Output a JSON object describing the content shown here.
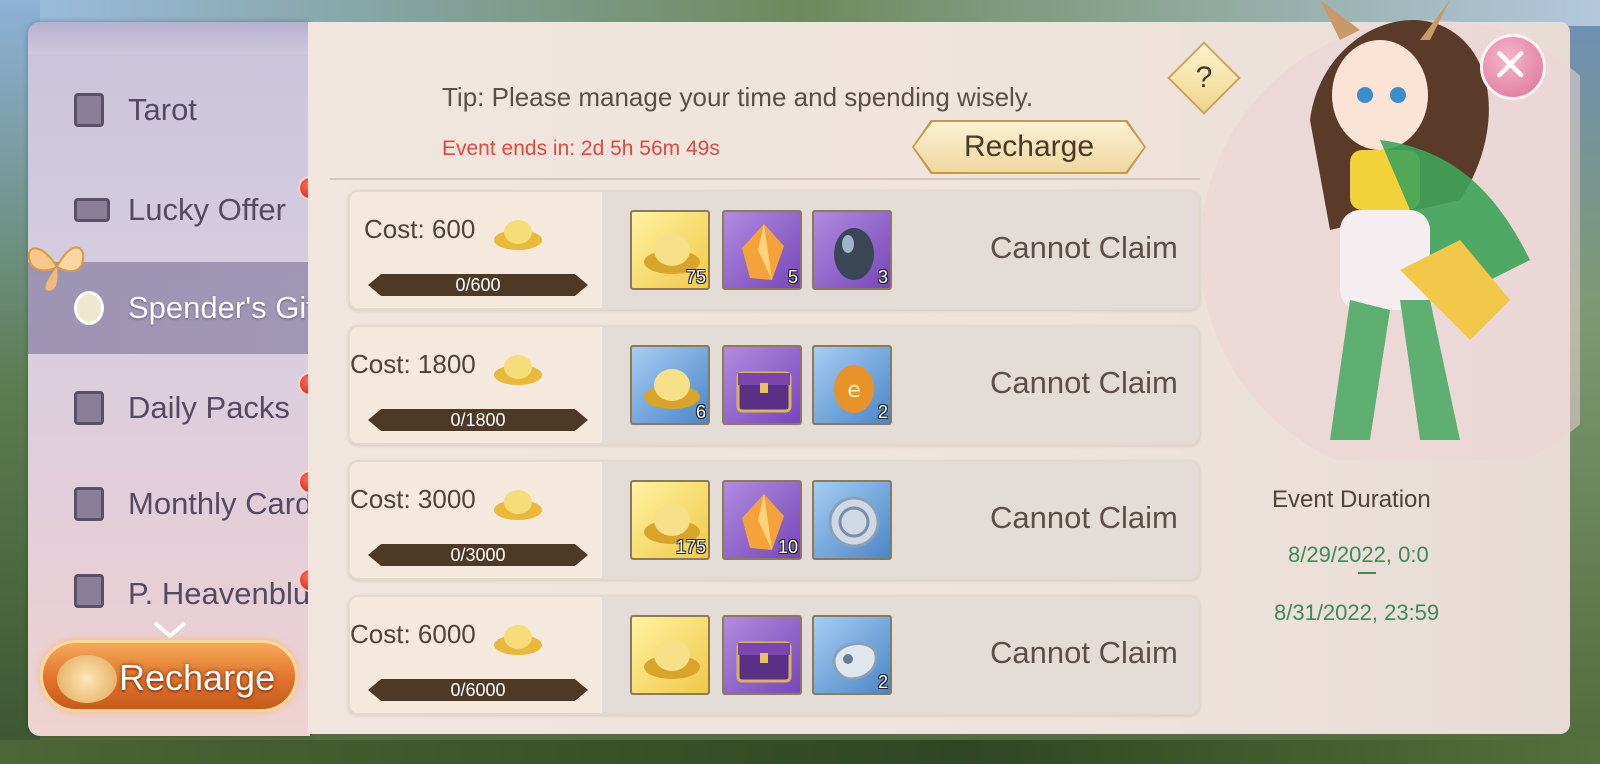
{
  "nav": {
    "items": [
      {
        "label": "Tarot",
        "icon": "tarot-card-icon",
        "badge": false,
        "active": false
      },
      {
        "label": "Lucky Offer",
        "icon": "ticket-icon",
        "badge": true,
        "active": false
      },
      {
        "label": "Spender's Gift",
        "icon": "ingot-icon",
        "badge": false,
        "active": true
      },
      {
        "label": "Daily Packs",
        "icon": "gift-box-icon",
        "badge": true,
        "active": false
      },
      {
        "label": "Monthly Card",
        "icon": "card-icon",
        "badge": true,
        "active": false
      },
      {
        "label": "P. Heavenblue",
        "icon": "shield-icon",
        "badge": true,
        "active": false
      }
    ],
    "recharge_label": "Recharge"
  },
  "header": {
    "tip": "Tip: Please manage your time and spending wisely.",
    "event_ends": "Event ends in: 2d 5h 56m 49s",
    "recharge_label": "Recharge",
    "help_label": "?"
  },
  "rewards": [
    {
      "cost": "Cost: 600",
      "progress": "0/600",
      "progress_fraction": 0,
      "status": "Cannot Claim",
      "items": [
        {
          "icon": "ingot-icon",
          "color": "gold",
          "count": "75"
        },
        {
          "icon": "crystal-icon",
          "color": "purple",
          "count": "5"
        },
        {
          "icon": "egg-icon",
          "color": "purple",
          "count": "3"
        }
      ]
    },
    {
      "cost": "Cost: 1800",
      "progress": "0/1800",
      "progress_fraction": 0,
      "status": "Cannot Claim",
      "items": [
        {
          "icon": "ingot-icon",
          "color": "blue",
          "count": "6"
        },
        {
          "icon": "chest-icon",
          "color": "purple",
          "count": ""
        },
        {
          "icon": "rune-stone-icon",
          "color": "blue",
          "count": "2"
        }
      ]
    },
    {
      "cost": "Cost: 3000",
      "progress": "0/3000",
      "progress_fraction": 0,
      "status": "Cannot Claim",
      "items": [
        {
          "icon": "ingot-icon",
          "color": "gold",
          "count": "175"
        },
        {
          "icon": "crystal-icon",
          "color": "purple",
          "count": "10"
        },
        {
          "icon": "silver-coin-icon",
          "color": "blue",
          "count": ""
        }
      ]
    },
    {
      "cost": "Cost: 6000",
      "progress": "0/6000",
      "progress_fraction": 0,
      "status": "Cannot Claim",
      "items": [
        {
          "icon": "ingot-icon",
          "color": "gold",
          "count": ""
        },
        {
          "icon": "chest-icon",
          "color": "purple",
          "count": ""
        },
        {
          "icon": "skull-relic-icon",
          "color": "blue",
          "count": "2"
        }
      ]
    }
  ],
  "duration": {
    "title": "Event Duration",
    "start": "8/29/2022, 0:0",
    "end": "8/31/2022, 23:59"
  },
  "colors": {
    "accent_red": "#e0493c",
    "date_green": "#3f8a5a",
    "badge_red": "#c8201c"
  }
}
